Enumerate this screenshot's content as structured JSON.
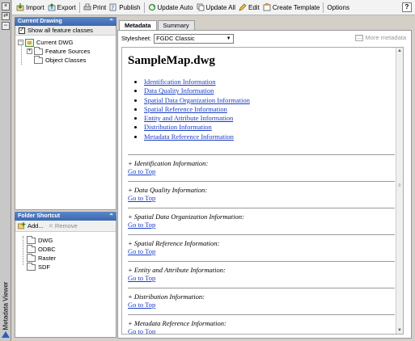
{
  "strip": {
    "title": "Metadata Viewer",
    "btn1": "×",
    "btn2": "⇄",
    "btn3": "⇔"
  },
  "toolbar": {
    "items": [
      {
        "label": "Import"
      },
      {
        "label": "Export"
      },
      {
        "label": "Print"
      },
      {
        "label": "Publish"
      },
      {
        "label": "Update Auto"
      },
      {
        "label": "Update All"
      },
      {
        "label": "Edit"
      },
      {
        "label": "Create Template"
      },
      {
        "label": "Options"
      }
    ],
    "help": "?"
  },
  "current_drawing": {
    "header": "Current Drawing",
    "show_all": "Show all feature classes",
    "root": "Current DWG",
    "children": [
      "Feature Sources",
      "Object Classes"
    ]
  },
  "folder_shortcut": {
    "header": "Folder Shortcut",
    "add": "Add...",
    "remove": "Remove",
    "items": [
      "DWG",
      "ODBC",
      "Raster",
      "SDF"
    ]
  },
  "tabs": [
    "Metadata",
    "Summary"
  ],
  "stylesheet": {
    "label": "Stylesheet:",
    "value": "FGDC Classic",
    "more": "More metadata"
  },
  "document": {
    "title": "SampleMap.dwg",
    "toc": [
      "Identification Information",
      "Data Quality Information",
      "Spatial Data Organization Information",
      "Spatial Reference Information",
      "Entity and Attribute Information",
      "Distribution Information",
      "Metadata Reference Information"
    ],
    "sections": [
      "+ Identification Information:",
      "+ Data Quality Information:",
      "+ Spatial Data Organization Information:",
      "+ Spatial Reference Information:",
      "+ Entity and Attribute Information:",
      "+ Distribution Information:",
      "+ Metadata Reference Information:"
    ],
    "go_to_top": "Go to Top"
  },
  "colors": {
    "link": "#1a3cc4",
    "panel_header": "#3c68b0"
  }
}
